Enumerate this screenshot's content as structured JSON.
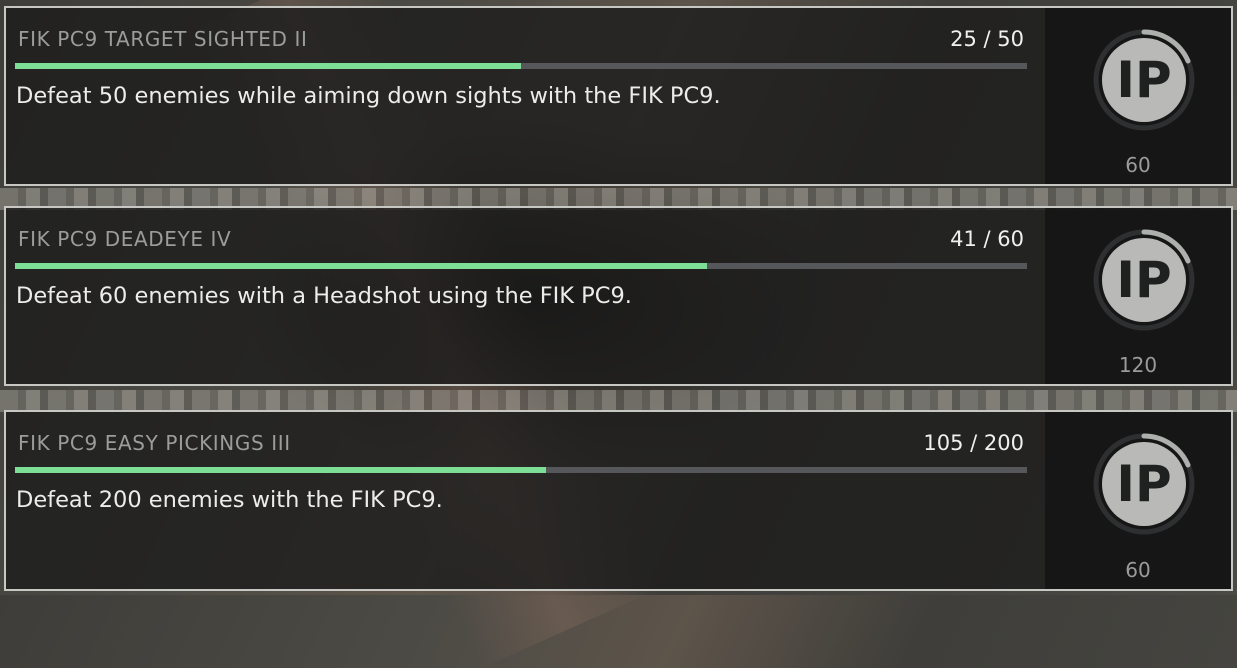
{
  "challenges": [
    {
      "title": "FIK PC9 TARGET SIGHTED II",
      "progress_text": "25 / 50",
      "current": 25,
      "target": 50,
      "description": "Defeat 50 enemies while aiming down sights with the FIK PC9.",
      "reward_amount": "60",
      "reward_icon": "ip-points-icon"
    },
    {
      "title": "FIK PC9 DEADEYE IV",
      "progress_text": "41 / 60",
      "current": 41,
      "target": 60,
      "description": "Defeat 60 enemies with a Headshot using the FIK PC9.",
      "reward_amount": "120",
      "reward_icon": "ip-points-icon"
    },
    {
      "title": "FIK PC9 EASY PICKINGS III",
      "progress_text": "105 / 200",
      "current": 105,
      "target": 200,
      "description": "Defeat 200 enemies with the FIK PC9.",
      "reward_amount": "60",
      "reward_icon": "ip-points-icon"
    }
  ],
  "reward_badge_text": "IP",
  "colors": {
    "progress_fill": "#7ddf96",
    "progress_track": "#56575a",
    "card_border": "#c7c7c3"
  }
}
